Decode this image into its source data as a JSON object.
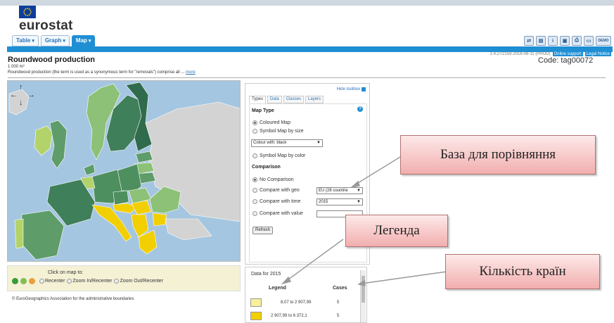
{
  "brand": "eurostat",
  "tabs": [
    {
      "label": "Table",
      "caret": "▾"
    },
    {
      "label": "Graph",
      "caret": "▾"
    },
    {
      "label": "Map",
      "caret": "▾"
    }
  ],
  "toolbar_icons": [
    "embed-icon",
    "export-icon",
    "info-icon",
    "save-icon",
    "print-icon",
    "bookmark-icon",
    "demo-icon"
  ],
  "demo_label": "DEMO",
  "version": "2.4.2-r2159-2016-08-11 (PROD)",
  "online_support": "Online support",
  "legal_notice": "Legal Notice",
  "page": {
    "title": "Roundwood production",
    "unit": "1 000 m³",
    "description": "Roundwood production (the term is used as a synonymous term for \"removals\") comprise all ...",
    "more": "more",
    "code": "Code: tag00072"
  },
  "map_nav": {
    "up": "↑",
    "left": "←",
    "right": "→",
    "down": "↓"
  },
  "click_box": {
    "title": "Click on map to:",
    "options": [
      "Recenter",
      "Zoom In/Recenter",
      "Zoom Out/Recenter"
    ]
  },
  "copyright": "© EuroGeographics Association for the administrative boundaries",
  "toolbox": {
    "hide": "Hide toolbox",
    "tabs": [
      "Types",
      "Data",
      "Classes",
      "Layers"
    ],
    "map_type_title": "Map Type",
    "coloured_map": "Coloured Map",
    "symbol_size": "Symbol Map by size",
    "colour_with_label": "Colour with:",
    "colour_with_value": "black",
    "symbol_color": "Symbol Map by color",
    "comparison_title": "Comparison",
    "no_comparison": "No Comparison",
    "compare_geo": "Compare with geo",
    "compare_geo_value": "EU (28 countrie",
    "compare_time": "Compare with time",
    "compare_time_value": "2015",
    "compare_value": "Compare with value",
    "refresh": "Refresh"
  },
  "legend": {
    "title": "Data for 2015",
    "col_legend": "Legend",
    "col_cases": "Cases",
    "rows": [
      {
        "from": "8,07",
        "to_word": "to",
        "to": "2 907,99",
        "cases": "5",
        "color": "#f7ef9a"
      },
      {
        "from": "2 907,99",
        "to_word": "to",
        "to": "6 372,1",
        "cases": "5",
        "color": "#f2cf00"
      }
    ]
  },
  "callouts": {
    "base": "База для порівняння",
    "legend": "Легенда",
    "count": "Кількість країн"
  },
  "colors": {
    "accent": "#1f8fd4",
    "sea": "#a5c6e0",
    "callout_fill": "#f4b8b8"
  }
}
